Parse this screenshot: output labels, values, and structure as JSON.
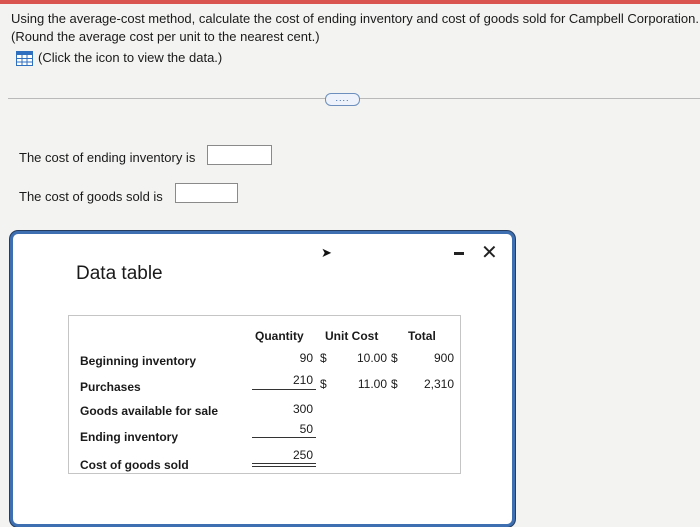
{
  "question": {
    "line1": "Using the average-cost method, calculate the cost of ending inventory and cost of goods sold for Campbell Corporation.",
    "line2": "(Round the average cost per unit to the nearest cent.)",
    "data_link": "(Click the icon to view the data.)"
  },
  "more_button": "....",
  "answers": {
    "ending_inventory_label": "The cost of ending inventory is",
    "cogs_label": "The cost of goods sold is",
    "ending_inventory_value": "",
    "cogs_value": ""
  },
  "modal": {
    "title": "Data table",
    "minimize": "-",
    "close": "✕"
  },
  "table": {
    "headers": {
      "quantity": "Quantity",
      "unit_cost": "Unit Cost",
      "total": "Total"
    },
    "rows": [
      {
        "label": "Beginning inventory",
        "quantity": "90",
        "dollar": "$",
        "unit_cost": "10.00",
        "unit_dollar": "$",
        "total": "900"
      },
      {
        "label": "Purchases",
        "quantity": "210",
        "dollar": "$",
        "unit_cost": "11.00",
        "unit_dollar": "$",
        "total": "2,310"
      },
      {
        "label": "Goods available for sale",
        "quantity": "300"
      },
      {
        "label": "Ending inventory",
        "quantity": "50"
      },
      {
        "label": "Cost of goods sold",
        "quantity": "250"
      }
    ]
  },
  "colors": {
    "accent": "#3e6fb0",
    "topbar": "#d9534f",
    "icon": "#2f6fbf"
  }
}
